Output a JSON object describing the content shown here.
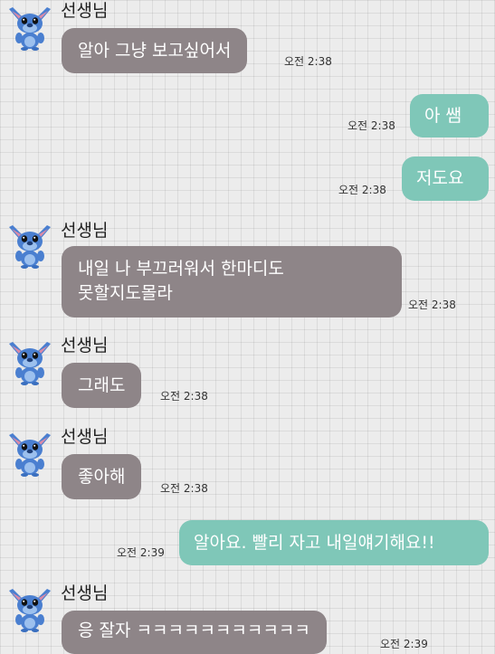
{
  "chat": {
    "messages": [
      {
        "type": "in",
        "sender": "선생님",
        "show_header": true,
        "text": "알아 그냥 보고싶어서",
        "time": "오전 2:38"
      },
      {
        "type": "out",
        "text": "아 쌤",
        "time": "오전 2:38"
      },
      {
        "type": "out",
        "text": "저도요",
        "time": "오전 2:38"
      },
      {
        "type": "in",
        "sender": "선생님",
        "show_header": true,
        "lines": [
          "내일 나 부끄러워서 한마디도",
          "못할지도몰라"
        ],
        "time": "오전 2:38"
      },
      {
        "type": "in",
        "sender": "선생님",
        "show_header": true,
        "text": "그래도",
        "time": "오전 2:38"
      },
      {
        "type": "in",
        "sender": "선생님",
        "show_header": true,
        "text": "좋아해",
        "time": "오전 2:38"
      },
      {
        "type": "out",
        "text": "알아요. 빨리 자고 내일얘기해요!!",
        "time": "오전 2:39"
      },
      {
        "type": "in",
        "sender": "선생님",
        "show_header": true,
        "text": "응 잘자 ㅋㅋㅋㅋㅋㅋㅋㅋㅋㅋㅋ",
        "time": "오전 2:39"
      }
    ],
    "colors": {
      "incoming_bubble": "#8e8588",
      "outgoing_bubble": "#7fc7b8",
      "avatar_character": "#4a7fd0"
    },
    "avatar_icon": "stitch-avatar-icon"
  }
}
